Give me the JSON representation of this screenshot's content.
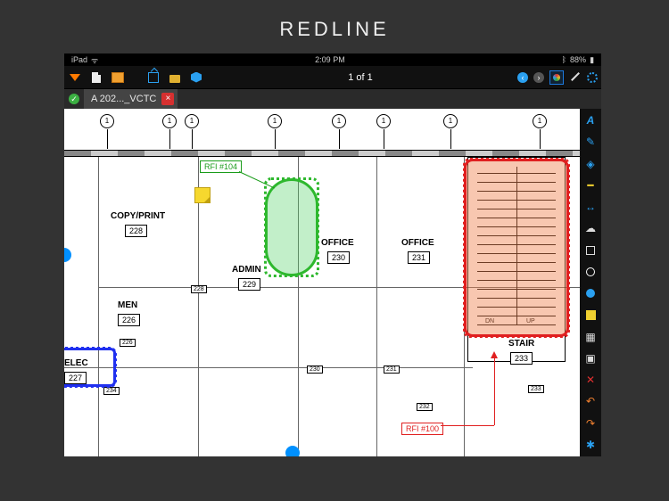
{
  "page": {
    "title": "REDLINE"
  },
  "status": {
    "device": "iPad",
    "wifi": "᷁",
    "time": "2:09 PM",
    "battery_pct": "88%"
  },
  "toolbar": {
    "page_indicator": "1 of 1"
  },
  "tab": {
    "label": "A 202..._VCTC",
    "close": "×"
  },
  "sidetools": {
    "text": "A",
    "undo": "↶",
    "redo": "↷",
    "delete": "✕"
  },
  "annotations": {
    "rfi_green": "RFI #104",
    "rfi_red": "RFI #100"
  },
  "rooms": {
    "copyprint": {
      "name": "COPY/PRINT",
      "num": "228"
    },
    "admin": {
      "name": "ADMIN",
      "num": "229"
    },
    "office1": {
      "name": "OFFICE",
      "num": "230"
    },
    "office2": {
      "name": "OFFICE",
      "num": "231"
    },
    "stair": {
      "name": "STAIR",
      "num": "233",
      "dn": "DN",
      "up": "UP"
    },
    "men": {
      "name": "MEN",
      "num": "226"
    },
    "elec": {
      "name": "ELEC",
      "num": "227"
    },
    "tag234": "234",
    "tag228s": "228",
    "tag226s": "226",
    "tag230s": "230",
    "tag231s": "231",
    "tag232s": "232",
    "tag233s": "233"
  },
  "grid": {
    "label": "1"
  }
}
